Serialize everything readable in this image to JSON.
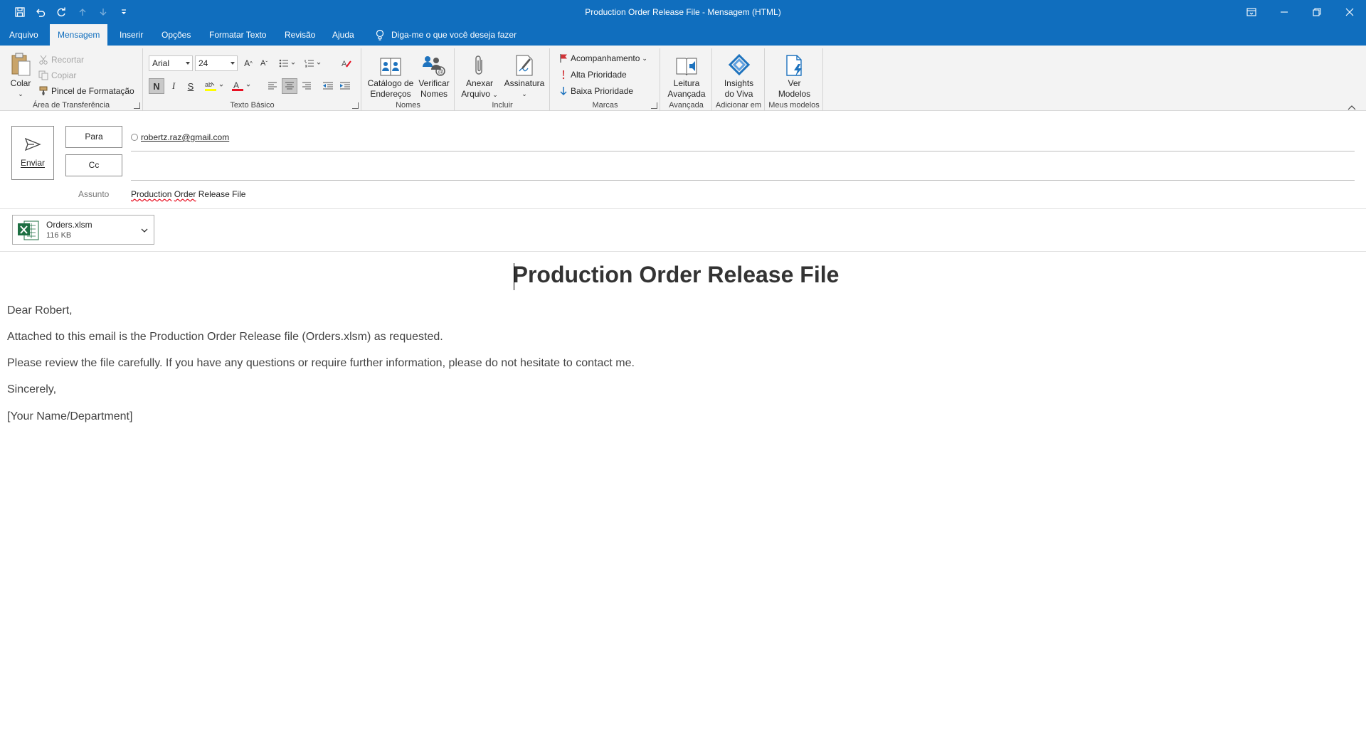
{
  "titlebar": {
    "title": "Production Order Release File  -  Mensagem (HTML)",
    "qa_icons": [
      "save-icon",
      "undo-icon",
      "redo-icon",
      "up-arrow-icon",
      "down-arrow-icon",
      "customize-icon"
    ],
    "window_icons": [
      "ribbon-display-icon",
      "minimize-icon",
      "restore-icon",
      "close-icon"
    ]
  },
  "tabs": {
    "items": [
      "Arquivo",
      "Mensagem",
      "Inserir",
      "Opções",
      "Formatar Texto",
      "Revisão",
      "Ajuda"
    ],
    "active": "Mensagem",
    "tell_me": "Diga-me o que você deseja fazer"
  },
  "ribbon": {
    "clipboard": {
      "paste": "Colar",
      "cut": "Recortar",
      "copy": "Copiar",
      "format_painter": "Pincel de Formatação",
      "label": "Área de Transferência"
    },
    "basic_text": {
      "font": "Arial",
      "size": "24",
      "bold": "N",
      "italic": "I",
      "underline": "S",
      "label": "Texto Básico"
    },
    "names": {
      "address_book": [
        "Catálogo de",
        "Endereços"
      ],
      "check_names": [
        "Verificar",
        "Nomes"
      ],
      "label": "Nomes"
    },
    "include": {
      "attach": [
        "Anexar",
        "Arquivo"
      ],
      "signature": "Assinatura",
      "label": "Incluir"
    },
    "tags": {
      "follow_up": "Acompanhamento",
      "high": "Alta Prioridade",
      "low": "Baixa Prioridade",
      "label": "Marcas"
    },
    "immersive": {
      "reader": [
        "Leitura",
        "Avançada"
      ],
      "label": "Avançada"
    },
    "addin": {
      "viva": [
        "Insights",
        "do Viva"
      ],
      "label": "Adicionar em"
    },
    "templates": {
      "view": [
        "Ver",
        "Modelos"
      ],
      "label": "Meus modelos"
    }
  },
  "compose": {
    "send": "Enviar",
    "to_label": "Para",
    "cc_label": "Cc",
    "to_value": "robertz.raz@gmail.com",
    "subject_label": "Assunto",
    "subject_word1": "Production",
    "subject_word2": "Order",
    "subject_rest": "Release File"
  },
  "attachment": {
    "name": "Orders.xlsm",
    "size": "116 KB"
  },
  "body": {
    "title": "Production Order Release File",
    "greeting": "Dear Robert,",
    "p1": "Attached to this email is the Production Order Release file (Orders.xlsm) as requested.",
    "p2": "Please review the file carefully. If you have any questions or require further information, please do not hesitate to contact me.",
    "closing": "Sincerely,",
    "signature": "[Your Name/Department]"
  },
  "colors": {
    "accent": "#106ebe",
    "excel": "#1d6f42",
    "flag": "#d13438"
  }
}
